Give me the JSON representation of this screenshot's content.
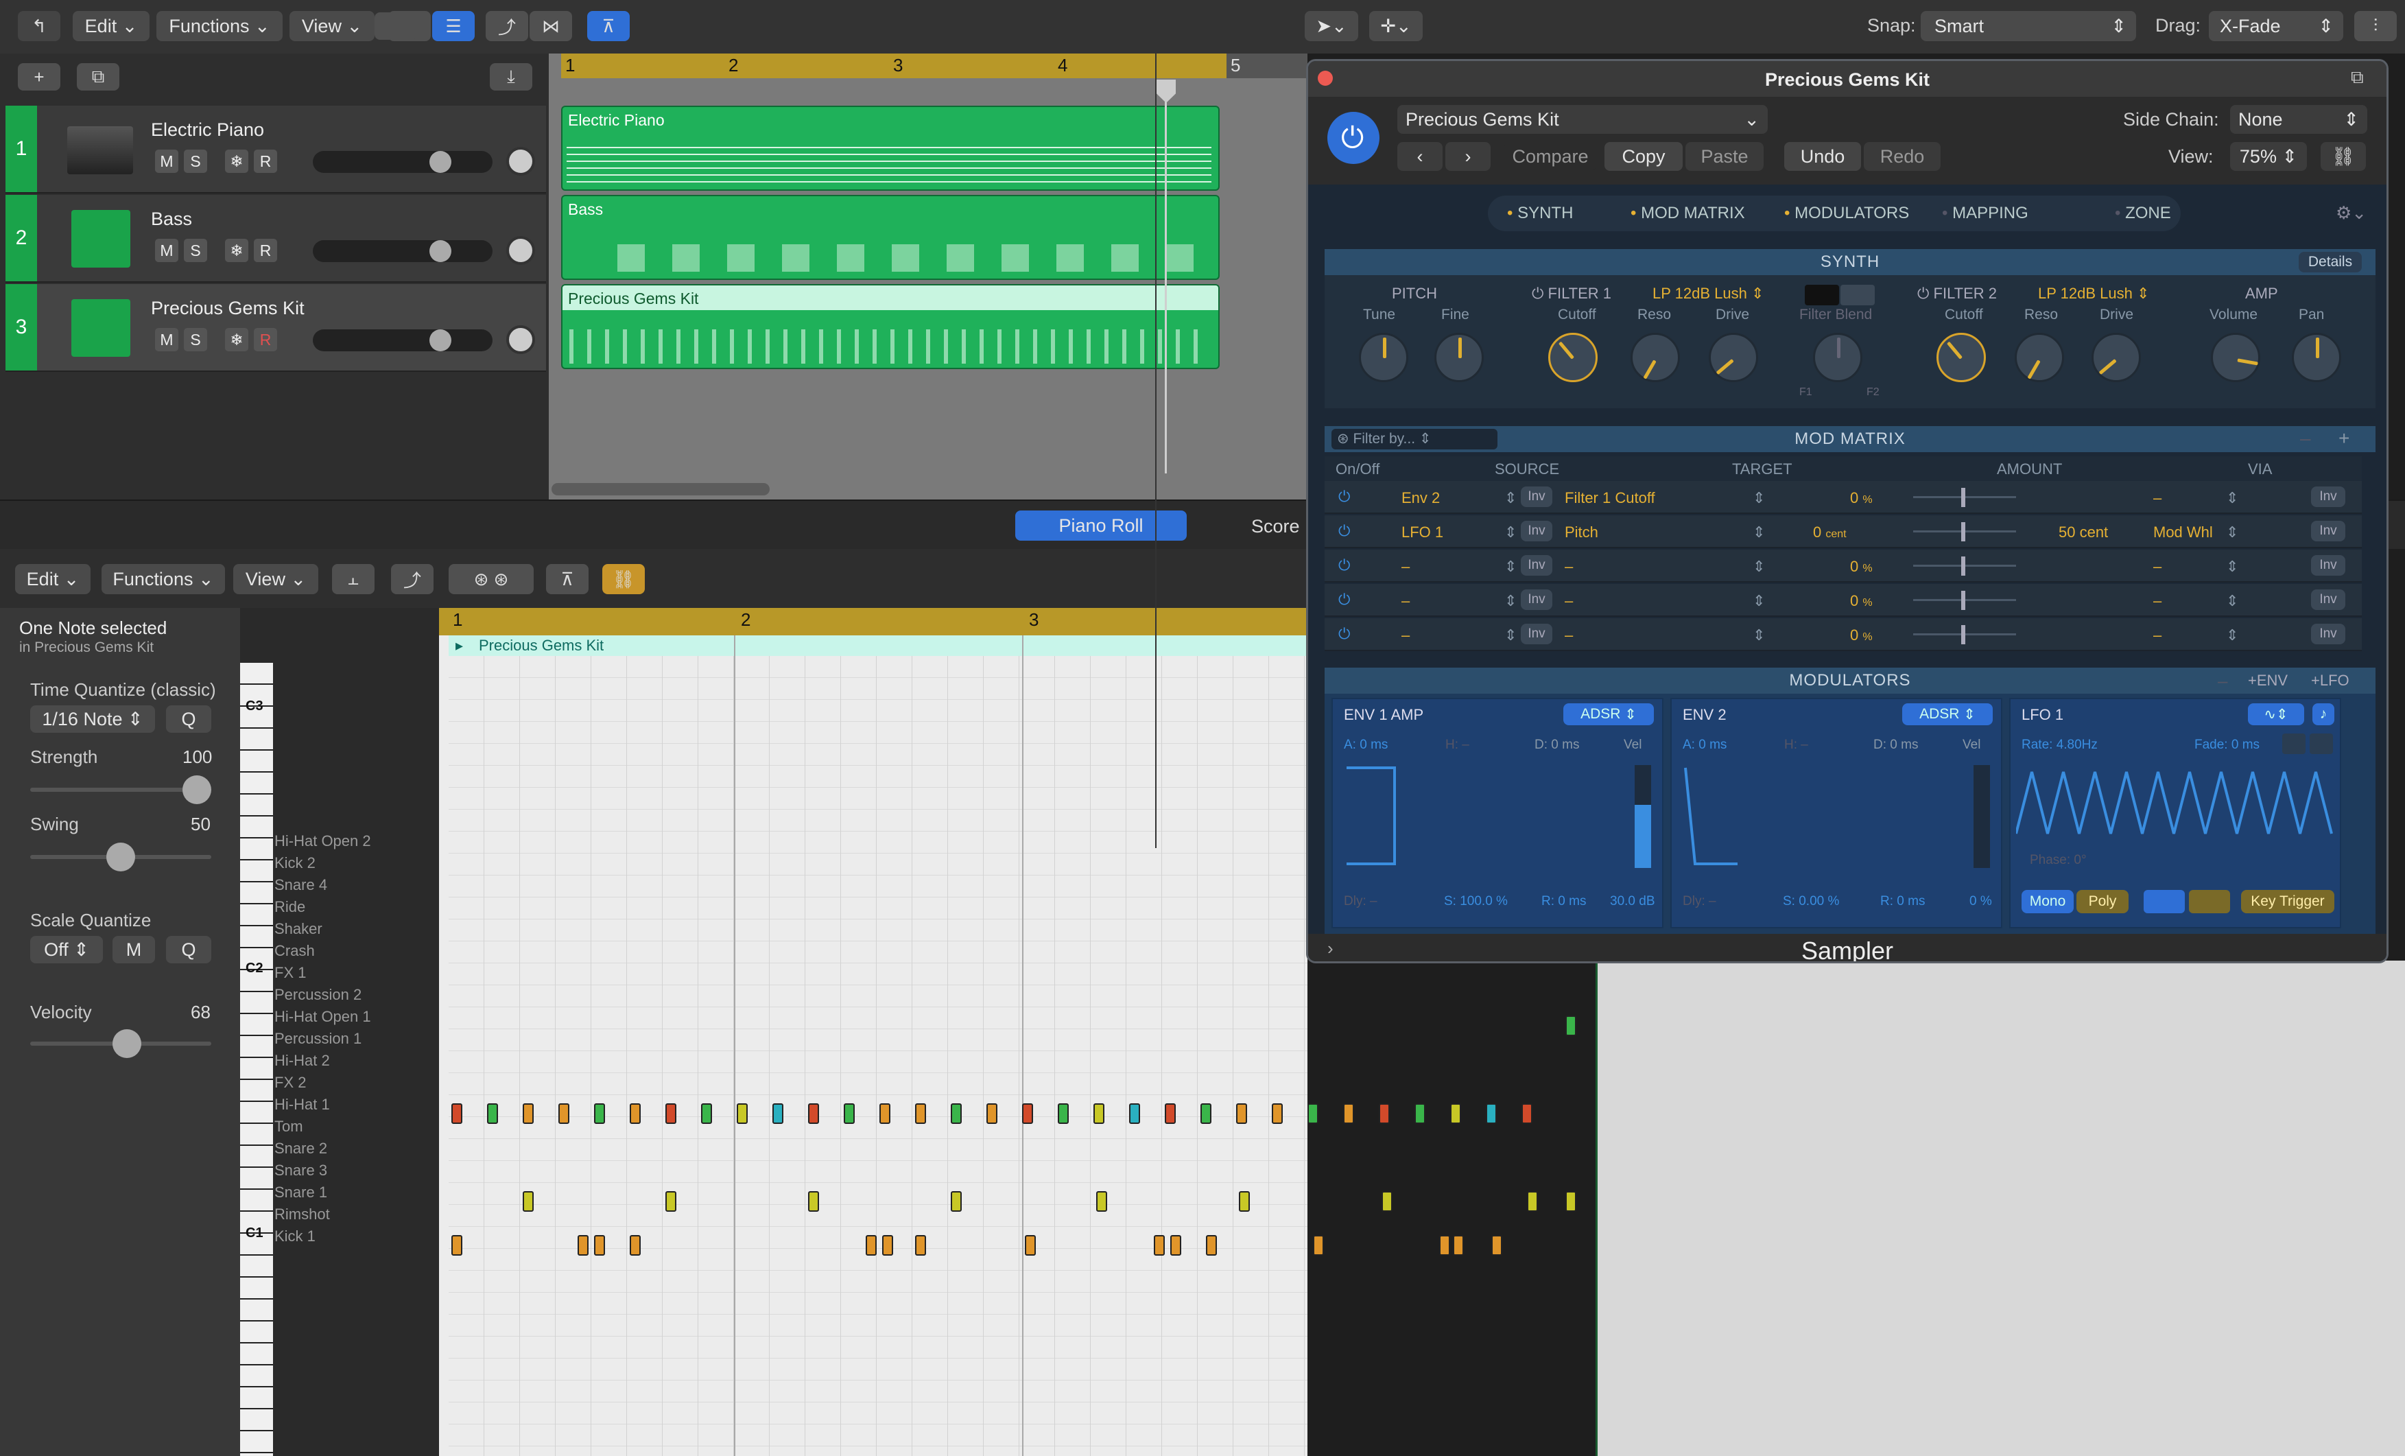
{
  "toolbar": {
    "edit": "Edit",
    "functions": "Functions",
    "view": "View",
    "snap_label": "Snap:",
    "snap_value": "Smart",
    "drag_label": "Drag:",
    "drag_value": "X-Fade"
  },
  "tracks": [
    {
      "num": "1",
      "name": "Electric Piano",
      "m": "M",
      "s": "S",
      "r": "R"
    },
    {
      "num": "2",
      "name": "Bass",
      "m": "M",
      "s": "S",
      "r": "R"
    },
    {
      "num": "3",
      "name": "Precious Gems Kit",
      "m": "M",
      "s": "S",
      "r": "R"
    }
  ],
  "arrange_ruler": [
    "1",
    "2",
    "3",
    "4",
    "5"
  ],
  "regions": [
    "Electric Piano",
    "Bass",
    "Precious Gems Kit"
  ],
  "editor_tabs": {
    "piano_roll": "Piano Roll",
    "score": "Score"
  },
  "editor_menu": {
    "edit": "Edit",
    "functions": "Functions",
    "view": "View"
  },
  "inspector": {
    "selection": "One Note selected",
    "selection_sub": "in Precious Gems Kit",
    "time_quantize_label": "Time Quantize (classic)",
    "time_quantize_value": "1/16 Note",
    "q": "Q",
    "strength_label": "Strength",
    "strength_value": "100",
    "strength_level": 1.0,
    "swing_label": "Swing",
    "swing_value": "50",
    "swing_level": 0.5,
    "scale_quantize_label": "Scale Quantize",
    "scale_quantize_value": "Off",
    "scale_quantize_mode": "M",
    "velocity_label": "Velocity",
    "velocity_value": "68",
    "velocity_level": 0.54
  },
  "piano_ruler": [
    "1",
    "2",
    "3"
  ],
  "piano_region_name": "Precious Gems Kit",
  "octave_labels": [
    "C3",
    "C2",
    "C1"
  ],
  "drum_keys": [
    "Hi-Hat Open 2",
    "Kick 2",
    "Snare 4",
    "Ride",
    "Shaker",
    "Crash",
    "FX 1",
    "Percussion 2",
    "Hi-Hat Open 1",
    "Percussion 1",
    "Hi-Hat 2",
    "FX 2",
    "Hi-Hat 1",
    "Tom",
    "Snare 2",
    "Snare 3",
    "Snare 1",
    "Rimshot",
    "Kick 1"
  ],
  "plugin": {
    "title": "Precious Gems Kit",
    "preset": "Precious Gems Kit",
    "compare": "Compare",
    "copy": "Copy",
    "paste": "Paste",
    "undo": "Undo",
    "redo": "Redo",
    "side_chain_label": "Side Chain:",
    "side_chain_value": "None",
    "view_label": "View:",
    "view_value": "75%",
    "tabs": [
      "SYNTH",
      "MOD MATRIX",
      "MODULATORS",
      "MAPPING",
      "ZONE"
    ],
    "synth_title": "SYNTH",
    "details": "Details",
    "pitch": "PITCH",
    "tune": "Tune",
    "fine": "Fine",
    "filter1": "FILTER 1",
    "filter1_type": "LP 12dB Lush",
    "filter2": "FILTER 2",
    "filter2_type": "LP 12dB Lush",
    "cutoff": "Cutoff",
    "reso": "Reso",
    "drive": "Drive",
    "filter_blend": "Filter Blend",
    "f1": "F1",
    "f2": "F2",
    "amp": "AMP",
    "volume": "Volume",
    "pan": "Pan",
    "mod_matrix_title": "MOD MATRIX",
    "filter_placeholder": "Filter by...",
    "mm_headers": [
      "On/Off",
      "SOURCE",
      "TARGET",
      "AMOUNT",
      "VIA"
    ],
    "mm_rows": [
      {
        "source": "Env 2",
        "target": "Filter 1 Cutoff",
        "amount": "0",
        "unit": "%",
        "amount2": "",
        "via": "–"
      },
      {
        "source": "LFO 1",
        "target": "Pitch",
        "amount": "0",
        "unit": "cent",
        "amount2": "50 cent",
        "via": "Mod Whl"
      },
      {
        "source": "–",
        "target": "–",
        "amount": "0",
        "unit": "%",
        "amount2": "",
        "via": "–"
      },
      {
        "source": "–",
        "target": "–",
        "amount": "0",
        "unit": "%",
        "amount2": "",
        "via": "–"
      },
      {
        "source": "–",
        "target": "–",
        "amount": "0",
        "unit": "%",
        "amount2": "",
        "via": "–"
      }
    ],
    "inv": "Inv",
    "modulators_title": "MODULATORS",
    "env_add": "+ENV",
    "lfo_add": "+LFO",
    "env1": {
      "title": "ENV 1 AMP",
      "mode": "ADSR",
      "a": "A: 0 ms",
      "h": "H: –",
      "d": "D: 0 ms",
      "vel": "Vel",
      "dly": "Dly: –",
      "s": "S: 100.0 %",
      "r": "R: 0 ms",
      "db": "30.0 dB"
    },
    "env2": {
      "title": "ENV 2",
      "mode": "ADSR",
      "a": "A: 0 ms",
      "h": "H: –",
      "d": "D: 0 ms",
      "vel": "Vel",
      "dly": "Dly: –",
      "s": "S: 0.00 %",
      "r": "R: 0 ms",
      "pct": "0 %"
    },
    "lfo1": {
      "title": "LFO 1",
      "rate": "Rate: 4.80Hz",
      "fade": "Fade: 0 ms",
      "phase": "Phase: 0°",
      "mono": "Mono",
      "poly": "Poly",
      "key_trigger": "Key Trigger"
    },
    "footer": "Sampler"
  }
}
